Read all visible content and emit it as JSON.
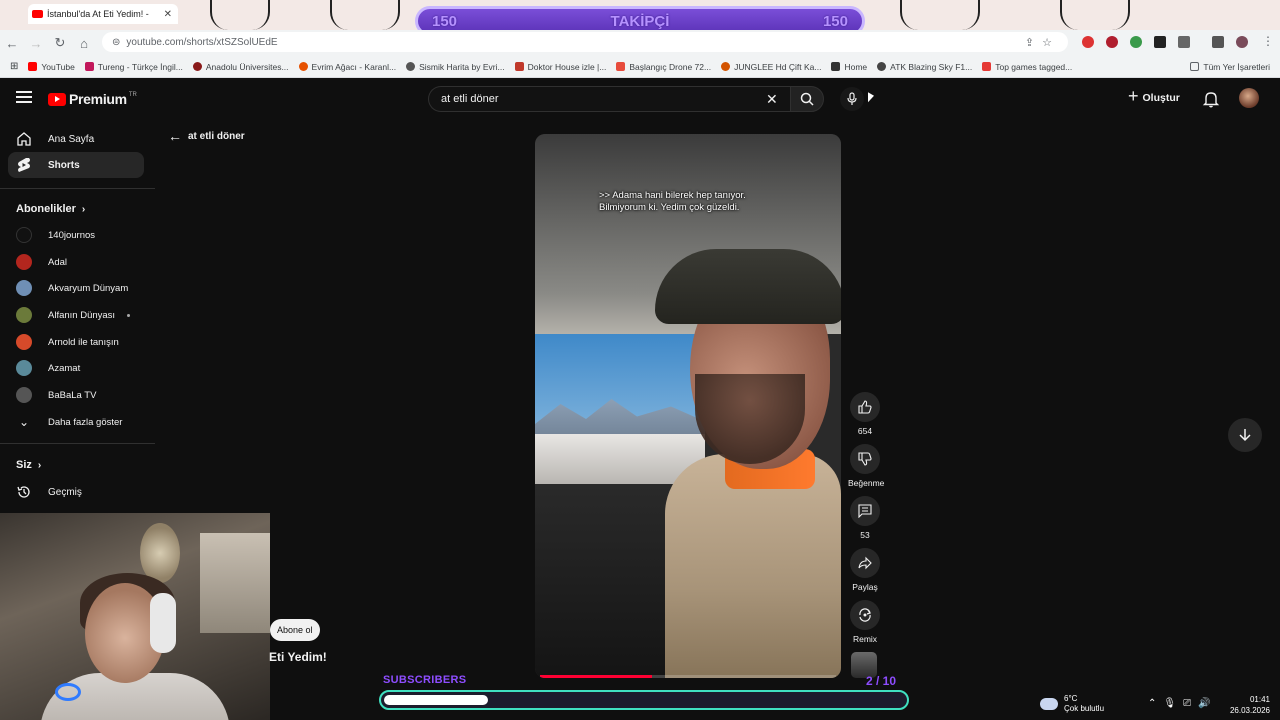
{
  "overlay": {
    "followers_left": "150",
    "followers_label": "TAKİPÇİ",
    "followers_right": "150",
    "subscribers_label": "SUBSCRIBERS",
    "subscribers_count": "2 / 10",
    "subscribers_progress": 0.2
  },
  "browser": {
    "tab_title": "İstanbul'da At Eti Yedim! -",
    "url": "youtube.com/shorts/xtSZSolUEdE",
    "bookmarks": [
      "YouTube",
      "Tureng - Türkçe İngil...",
      "Anadolu Üniversites...",
      "Evrim Ağacı - Karanl...",
      "Sismik Harita by Evri...",
      "Doktor House izle |...",
      "Başlangıç Drone 72...",
      "JUNGLEE Hd Çift Ka...",
      "Home",
      "ATK Blazing Sky F1...",
      "Top games tagged..."
    ],
    "bookmarks_all": "Tüm Yer İşaretleri"
  },
  "youtube": {
    "logo_text": "Premium",
    "logo_region": "TR",
    "search_value": "at etli döner",
    "create_label": "Oluştur"
  },
  "sidebar": {
    "items": [
      {
        "label": "Ana Sayfa"
      },
      {
        "label": "Shorts"
      }
    ],
    "subscriptions_heading": "Abonelikler",
    "subscriptions": [
      {
        "label": "140journos",
        "color": "#111111"
      },
      {
        "label": "Adal",
        "color": "#b3261e"
      },
      {
        "label": "Akvaryum Dünyam",
        "color": "#6f8fb5"
      },
      {
        "label": "Alfanın Dünyası",
        "color": "#6b7a3a"
      },
      {
        "label": "Arnold ile tanışın",
        "color": "#d64a2a"
      },
      {
        "label": "Azamat",
        "color": "#5a8a9a"
      },
      {
        "label": "BaBaLa TV",
        "color": "#555555"
      }
    ],
    "show_more": "Daha fazla göster",
    "you_heading": "Siz",
    "history": "Geçmiş"
  },
  "shorts": {
    "back_query": "at etli döner",
    "subtitle_line1": ">> Adama hani bilerek hep tanıyor.",
    "subtitle_line2": "Bilmiyorum ki. Yedim çok güzeldi.",
    "likes": "654",
    "dislike_label": "Beğenme",
    "comments": "53",
    "share_label": "Paylaş",
    "remix_label": "Remix",
    "subscribe_label": "Abone ol",
    "title_partial": "Eti Yedim!",
    "progress": 0.38
  },
  "taskbar": {
    "temp": "6°C",
    "weather": "Çok bulutlu",
    "time": "01:41",
    "date": "26.03.2026"
  }
}
